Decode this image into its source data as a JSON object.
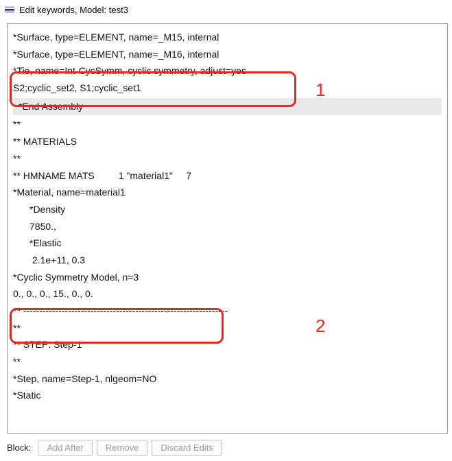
{
  "window": {
    "title": "Edit keywords, Model: test3"
  },
  "code": {
    "l01": "*Surface, type=ELEMENT, name=_M15, internal",
    "l02": "*Surface, type=ELEMENT, name=_M16, internal",
    "l03": "*Tie, name=Int-CycSymm, cyclic symmetry, adjust=yes",
    "l04": "S2;cyclic_set2, S1;cyclic_set1",
    "l05": "*End Assembly",
    "l06": "**",
    "l07": "** MATERIALS",
    "l08": "**",
    "l09": "** HMNAME MATS         1 \"material1\"     7",
    "l10": "*Material, name=material1",
    "l11": "*Density",
    "l12": "7850.,",
    "l13": "*Elastic",
    "l14": " 2.1e+11, 0.3",
    "l15": "*Cyclic Symmetry Model, n=3",
    "l16": "0., 0., 0., 15., 0., 0.",
    "l17": "** ----------------------------------------------------------------",
    "l18": "**",
    "l19": "** STEP: Step-1",
    "l20": "**",
    "l21": "*Step, name=Step-1, nlgeom=NO",
    "l22": "*Static"
  },
  "annotations": {
    "n1": "1",
    "n2": "2"
  },
  "toolbar": {
    "block_label": "Block:",
    "add_after": "Add After",
    "remove": "Remove",
    "discard": "Discard Edits"
  }
}
